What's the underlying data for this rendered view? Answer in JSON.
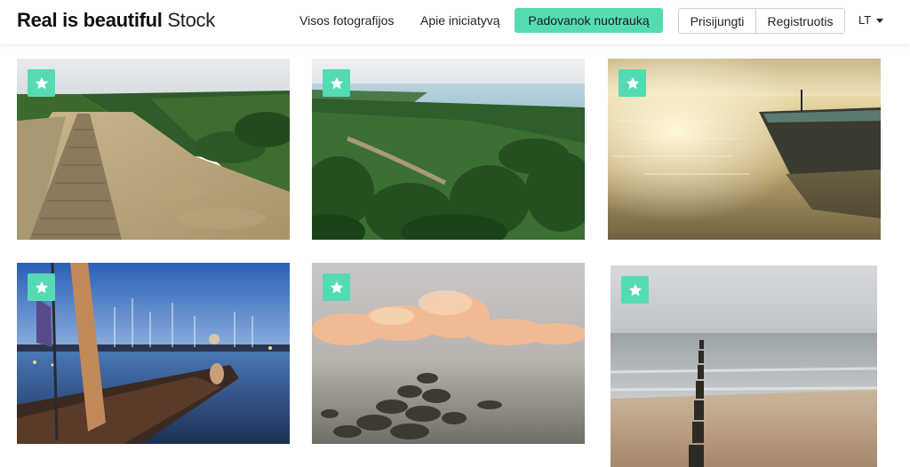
{
  "header": {
    "logo_bold": "Real is beautiful",
    "logo_light": "Stock",
    "nav": {
      "all_photos": "Visos fotografijos",
      "about": "Apie iniciatyvą",
      "donate": "Padovanok nuotrauką"
    },
    "auth": {
      "login": "Prisijungti",
      "register": "Registruotis"
    },
    "language": "LT"
  },
  "gallery": {
    "badge_icon": "star-icon",
    "accent_color": "#55dbb3",
    "photos": [
      {
        "subject": "dune-boardwalk"
      },
      {
        "subject": "forest-coast-view"
      },
      {
        "subject": "boat-at-sunset"
      },
      {
        "subject": "harbor-sailboat-night"
      },
      {
        "subject": "stony-shore-clouds"
      },
      {
        "subject": "breakwater-sea"
      }
    ]
  }
}
